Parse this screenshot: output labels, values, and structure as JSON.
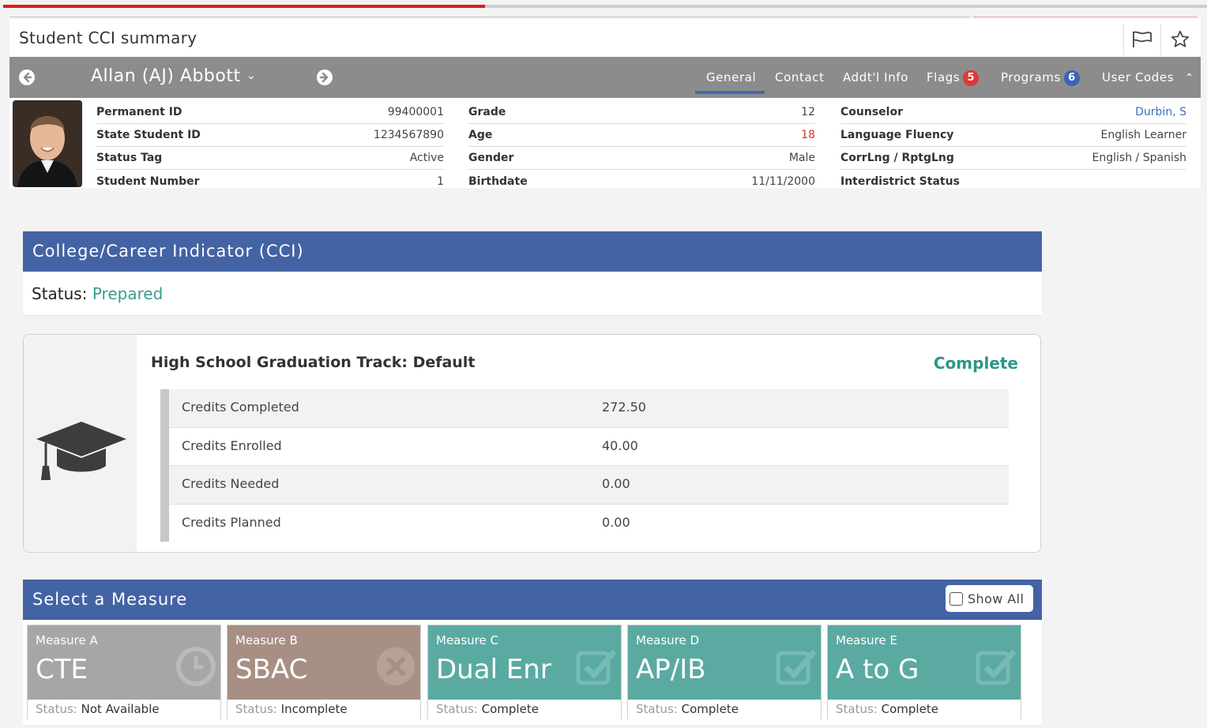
{
  "page": {
    "title": "Student CCI summary"
  },
  "student": {
    "name": "Allan (AJ) Abbott",
    "tabs": [
      {
        "label": "General"
      },
      {
        "label": "Contact"
      },
      {
        "label": "Addt'l Info"
      },
      {
        "label": "Flags",
        "badge": "5"
      },
      {
        "label": "Programs",
        "badge": "6"
      },
      {
        "label": "User Codes"
      }
    ],
    "col1": [
      {
        "label": "Permanent ID",
        "value": "99400001"
      },
      {
        "label": "State Student ID",
        "value": "1234567890"
      },
      {
        "label": "Status Tag",
        "value": "Active"
      },
      {
        "label": "Student Number",
        "value": "1"
      }
    ],
    "col2": [
      {
        "label": "Grade",
        "value": "12"
      },
      {
        "label": "Age",
        "value": "18"
      },
      {
        "label": "Gender",
        "value": "Male"
      },
      {
        "label": "Birthdate",
        "value": "11/11/2000"
      }
    ],
    "col3": [
      {
        "label": "Counselor",
        "value": "Durbin, S"
      },
      {
        "label": "Language Fluency",
        "value": "English Learner"
      },
      {
        "label": "CorrLng / RptgLng",
        "value": "English / Spanish"
      },
      {
        "label": "Interdistrict Status",
        "value": ""
      }
    ]
  },
  "cci": {
    "heading": "College/Career Indicator (CCI)",
    "status_label": "Status:",
    "status_value": "Prepared"
  },
  "graduation": {
    "track": "High School Graduation Track: Default",
    "status": "Complete",
    "rows": [
      {
        "label": "Credits Completed",
        "value": "272.50"
      },
      {
        "label": "Credits Enrolled",
        "value": "40.00"
      },
      {
        "label": "Credits Needed",
        "value": "0.00"
      },
      {
        "label": "Credits Planned",
        "value": "0.00"
      }
    ]
  },
  "measures": {
    "heading": "Select a Measure",
    "show_all": "Show All",
    "status_prefix": "Status:",
    "items": [
      {
        "label": "Measure A",
        "name": "CTE",
        "status": "Not Available",
        "color": "#a6a6a6",
        "icon": "clock-icon"
      },
      {
        "label": "Measure B",
        "name": "SBAC",
        "status": "Incomplete",
        "color": "#a88f84",
        "icon": "x-circle-icon"
      },
      {
        "label": "Measure C",
        "name": "Dual Enr",
        "status": "Complete",
        "color": "#5aaaa2",
        "icon": "checkbox-icon"
      },
      {
        "label": "Measure D",
        "name": "AP/IB",
        "status": "Complete",
        "color": "#5aaaa2",
        "icon": "checkbox-icon"
      },
      {
        "label": "Measure E",
        "name": "A to G",
        "status": "Complete",
        "color": "#5aaaa2",
        "icon": "checkbox-icon"
      }
    ]
  },
  "colors": {
    "accent_blue": "#4463a5",
    "teal": "#2d968a",
    "age_red": "#d9312b",
    "counselor_link": "#3b6fc1"
  }
}
